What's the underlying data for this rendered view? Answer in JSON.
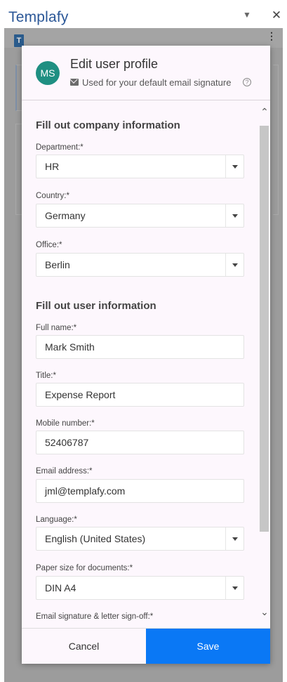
{
  "pane": {
    "title": "Templafy",
    "menu_glyph": "▼",
    "close_glyph": "✕"
  },
  "background_app": {
    "logo_letter": "T",
    "kebab_glyph": "⋮"
  },
  "modal": {
    "avatar_initials": "MS",
    "title": "Edit user profile",
    "subtitle": "Used for your default email signature",
    "help_glyph": "?",
    "sections": {
      "company": "Fill out company information",
      "user": "Fill out user information"
    },
    "fields": {
      "department": {
        "label": "Department:*",
        "value": "HR"
      },
      "country": {
        "label": "Country:*",
        "value": "Germany"
      },
      "office": {
        "label": "Office:*",
        "value": "Berlin"
      },
      "full_name": {
        "label": "Full name:*",
        "value": "Mark Smith"
      },
      "title": {
        "label": "Title:*",
        "value": "Expense Report"
      },
      "mobile": {
        "label": "Mobile number:*",
        "value": "52406787"
      },
      "email": {
        "label": "Email address:*",
        "value": "jml@templafy.com"
      },
      "language": {
        "label": "Language:*",
        "value": "English (United States)"
      },
      "paper_size": {
        "label": "Paper size for documents:*",
        "value": "DIN A4"
      },
      "signature": {
        "label": "Email signature & letter sign-off:*",
        "value": ""
      }
    },
    "scroll": {
      "up_glyph": "⌃",
      "down_glyph": "⌄"
    },
    "footer": {
      "cancel_label": "Cancel",
      "save_label": "Save"
    }
  },
  "colors": {
    "pane_title": "#2b5797",
    "avatar": "#1f8f82",
    "save_button": "#0a78f5",
    "modal_bg": "#fdf7fd"
  }
}
